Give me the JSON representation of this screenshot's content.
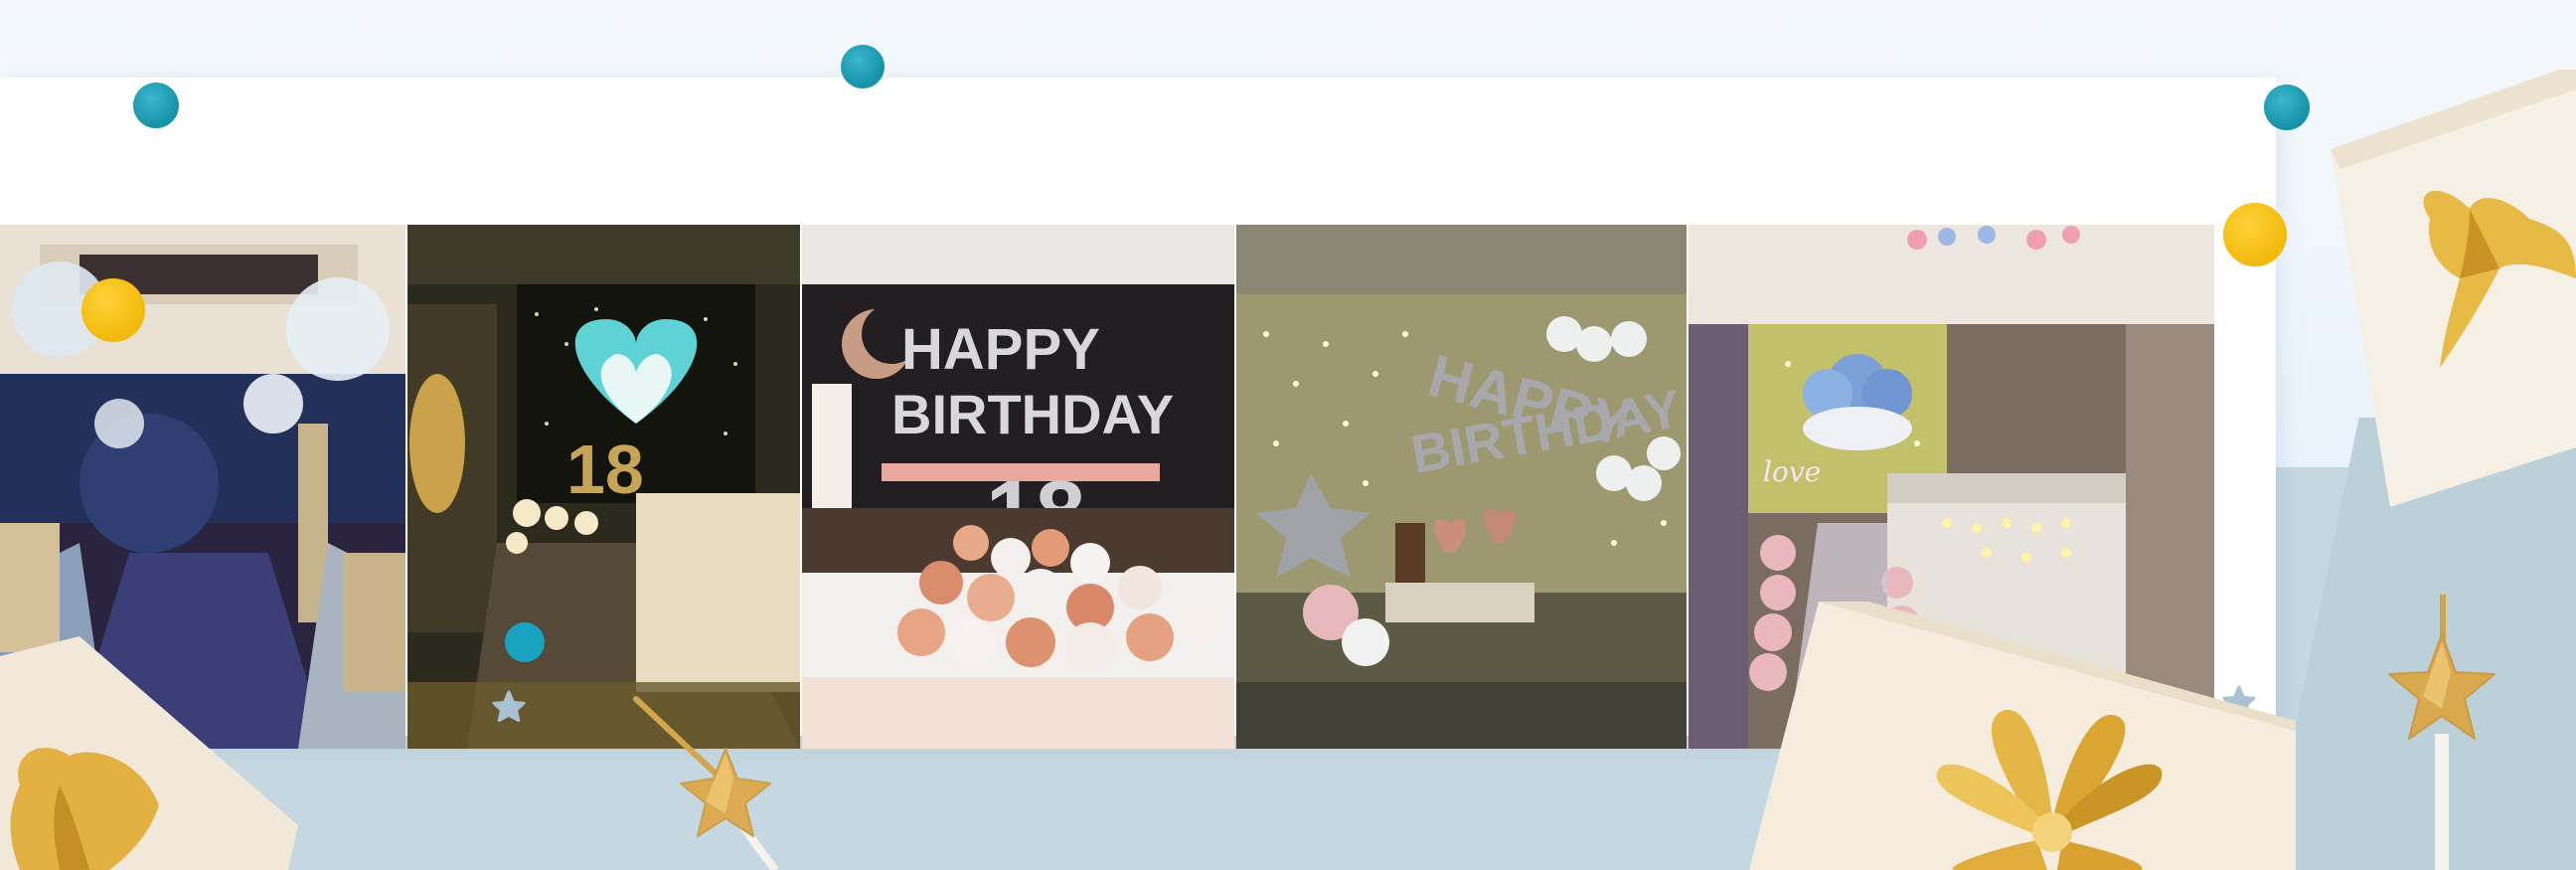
{
  "banner": {
    "photos": [
      {
        "id": "wedding-hall",
        "alt": "wedding hall balloon decoration"
      },
      {
        "id": "heart-balloon-room",
        "alt": "heart balloon corridor with number 18"
      },
      {
        "id": "happy-birthday-bed",
        "alt": "happy birthday bedroom balloons"
      },
      {
        "id": "fairy-lights-wall",
        "alt": "happy birthday fairy lights wall"
      },
      {
        "id": "love-hotel-room",
        "alt": "hotel room romantic decoration"
      }
    ],
    "texts": {
      "happy": "HAPPY",
      "birthday": "BIRTHDAY",
      "number": "18",
      "love": "love"
    }
  },
  "colors": {
    "teal": "#1a9fb5",
    "yellow": "#f4c21a",
    "gold": "#d9ad48",
    "frame": "#ffffff",
    "bottom": "#c5d8e1"
  }
}
